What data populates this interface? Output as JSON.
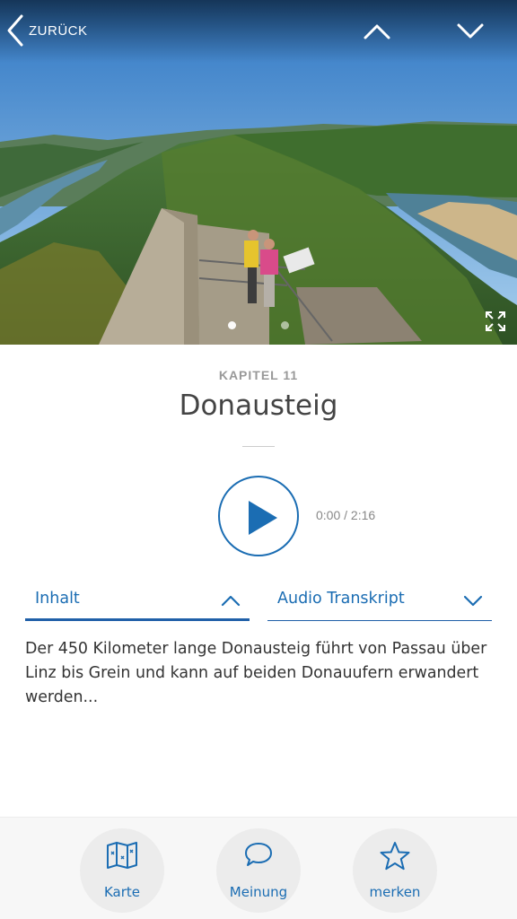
{
  "header": {
    "back_label": "ZURÜCK"
  },
  "hero": {
    "image_description_icon": "landscape-photo",
    "slide_count": 2,
    "active_slide": 1
  },
  "chapter": {
    "label": "KAPITEL 11",
    "title": "Donausteig"
  },
  "player": {
    "time": "0:00 / 2:16"
  },
  "tabs": [
    {
      "label": "Inhalt",
      "expanded": true
    },
    {
      "label": "Audio Transkript",
      "expanded": false
    }
  ],
  "content": {
    "text": "Der 450 Kilometer lange Donausteig führt von Passau über Linz bis Grein und kann auf beiden Donauufern erwandert werden..."
  },
  "bottom_nav": [
    {
      "label": "Karte",
      "icon": "map-icon"
    },
    {
      "label": "Meinung",
      "icon": "speech-bubble-icon"
    },
    {
      "label": "merken",
      "icon": "star-icon"
    }
  ],
  "colors": {
    "accent": "#1b6db3",
    "text": "#333333",
    "muted": "#999999"
  }
}
